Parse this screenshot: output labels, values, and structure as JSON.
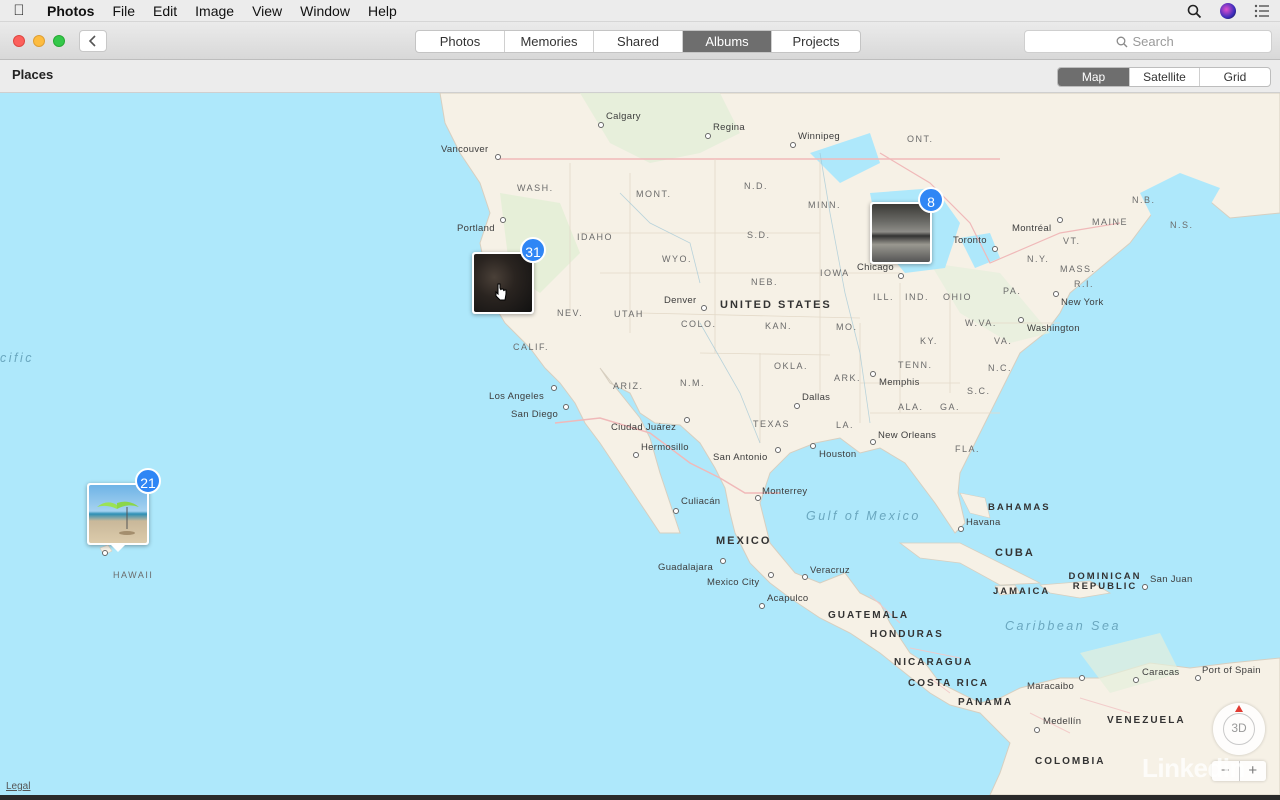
{
  "menubar": {
    "app_name": "Photos",
    "items": [
      "File",
      "Edit",
      "Image",
      "View",
      "Window",
      "Help"
    ],
    "icons": [
      "apple-icon",
      "search-icon",
      "siri-icon",
      "list-icon"
    ]
  },
  "toolbar": {
    "tabs": [
      {
        "label": "Photos",
        "active": false
      },
      {
        "label": "Memories",
        "active": false
      },
      {
        "label": "Shared",
        "active": false
      },
      {
        "label": "Albums",
        "active": true
      },
      {
        "label": "Projects",
        "active": false
      }
    ],
    "search_placeholder": "Search"
  },
  "places": {
    "title": "Places",
    "view_modes": [
      {
        "label": "Map",
        "active": true
      },
      {
        "label": "Satellite",
        "active": false
      },
      {
        "label": "Grid",
        "active": false
      }
    ]
  },
  "map": {
    "countries": [
      "UNITED STATES",
      "MEXICO",
      "CUBA",
      "JAMAICA",
      "DOMINICAN REPUBLIC",
      "GUATEMALA",
      "HONDURAS",
      "NICARAGUA",
      "COSTA RICA",
      "PANAMA",
      "VENEZUELA",
      "COLOMBIA",
      "BAHAMAS"
    ],
    "seas": [
      "Gulf of Mexico",
      "Caribbean Sea",
      "cific"
    ],
    "regions": [
      "WASH.",
      "MONT.",
      "N.D.",
      "MINN.",
      "IDAHO",
      "S.D.",
      "WYO.",
      "NEB.",
      "IOWA",
      "NEV.",
      "UTAH",
      "COLO.",
      "KAN.",
      "MO.",
      "CALIF.",
      "ARIZ.",
      "N.M.",
      "OKLA.",
      "ARK.",
      "TEXAS",
      "LA.",
      "ALA.",
      "GA.",
      "S.C.",
      "TENN.",
      "KY.",
      "N.C.",
      "VA.",
      "W.VA.",
      "OHIO",
      "PA.",
      "ILL.",
      "IND.",
      "N.Y.",
      "VT.",
      "MAINE",
      "MASS.",
      "R.I.",
      "ONT.",
      "N.B.",
      "N.S.",
      "FLA.",
      "HAWAII"
    ],
    "cities": [
      "Calgary",
      "Regina",
      "Winnipeg",
      "Vancouver",
      "Portland",
      "Toronto",
      "Montréal",
      "Chicago",
      "Denver",
      "New York",
      "Washington",
      "Memphis",
      "Dallas",
      "Los Angeles",
      "San Diego",
      "Ciudad Juárez",
      "Hermosillo",
      "San Antonio",
      "Houston",
      "New Orleans",
      "Culiacán",
      "Monterrey",
      "Havana",
      "Guadalajara",
      "Mexico City",
      "Veracruz",
      "Acapulco",
      "San Juan",
      "Caracas",
      "Port of Spain",
      "Maracaibo",
      "Medellín"
    ],
    "pins": [
      {
        "name": "pin-hawaii",
        "count": "21"
      },
      {
        "name": "pin-california",
        "count": "31"
      },
      {
        "name": "pin-chicago",
        "count": "8"
      }
    ],
    "compass_label": "3D",
    "zoom_out": "−",
    "zoom_in": "+",
    "legal": "Legal",
    "watermark": "Linkedin"
  }
}
